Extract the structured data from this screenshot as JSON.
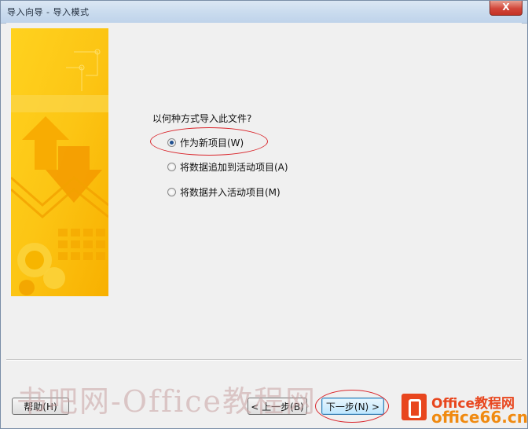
{
  "window": {
    "title": "导入向导 - 导入模式",
    "close_symbol": "X"
  },
  "question": "以何种方式导入此文件?",
  "options": [
    {
      "label": "作为新项目(W)",
      "selected": true
    },
    {
      "label": "将数据追加到活动项目(A)",
      "selected": false
    },
    {
      "label": "将数据并入活动项目(M)",
      "selected": false
    }
  ],
  "buttons": {
    "help": "帮助(H)",
    "back": "< 上一步(B)",
    "next": "下一步(N) >"
  },
  "watermark": "书吧网-Office教程网",
  "brand": {
    "line1": "Office教程网",
    "line2": "office66.cn"
  },
  "colors": {
    "banner": "#fdbf12",
    "annotation": "#d9262c",
    "brand": "#e8461e"
  }
}
